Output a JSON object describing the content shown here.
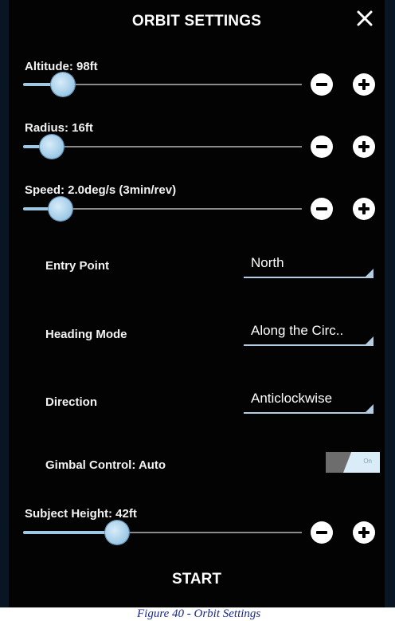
{
  "dialog": {
    "title": "ORBIT SETTINGS",
    "close_icon": "close-icon"
  },
  "sliders": [
    {
      "label": "Altitude: 98ft",
      "level": 0.11
    },
    {
      "label": "Radius: 16ft",
      "level": 0.06
    },
    {
      "label": "Speed: 2.0deg/s (3min/rev)",
      "level": 0.09
    },
    {
      "label": "Subject Height: 42ft",
      "level": 0.31
    }
  ],
  "stepper_icons": {
    "minus": "minus-circle-icon",
    "plus": "plus-circle-icon"
  },
  "dropdowns": {
    "entry_point": {
      "label": "Entry Point",
      "value": "North"
    },
    "heading_mode": {
      "label": "Heading Mode",
      "value": "Along the Circ.."
    },
    "direction": {
      "label": "Direction",
      "value": "Anticlockwise"
    }
  },
  "gimbal": {
    "label": "Gimbal Control: Auto",
    "toggle_text": "On",
    "state": "on"
  },
  "start_label": "START",
  "caption": "Figure 40 - Orbit Settings",
  "colors": {
    "background": "#030303",
    "slider_accent": "#9fc7e3",
    "text": "#ffffff",
    "toggle_on": "#d9ecf8",
    "caption": "#1a2a8a"
  }
}
